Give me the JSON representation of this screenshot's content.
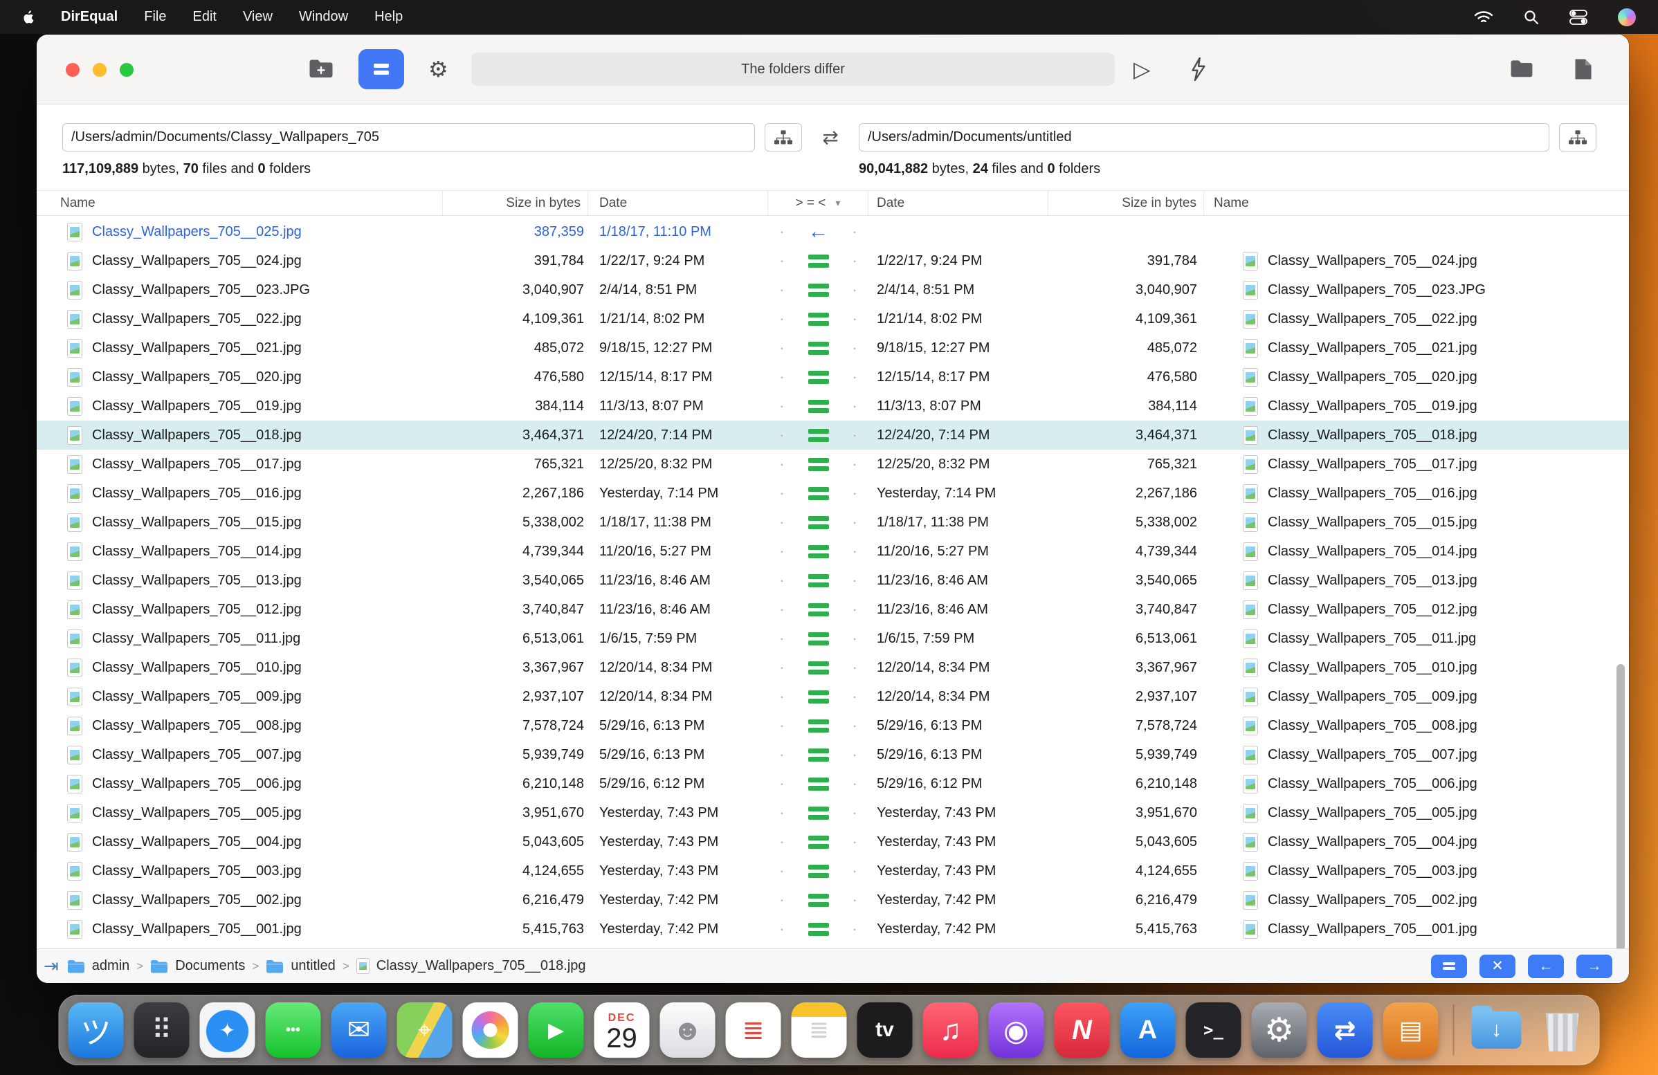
{
  "colors": {
    "accent": "#3d7bf7",
    "equal_green": "#2fae4d",
    "diff_blue": "#2e62d9",
    "selection": "#d7edef"
  },
  "icons": {
    "left_arrow": "←",
    "dot": "·",
    "chevron": "▾",
    "swap": "⇄",
    "play": "▷",
    "gear": "⚙",
    "bolt": "↯",
    "goto": "⇥",
    "breadcrumb_sep": ">",
    "copy_left": "←",
    "copy_right": "→",
    "diff_filter": "✕",
    "messages_glyph": "•••"
  },
  "menu_bar": {
    "app_name": "DirEqual",
    "menus": [
      "File",
      "Edit",
      "View",
      "Window",
      "Help"
    ]
  },
  "labels": {
    "bytes_sep": " bytes, ",
    "files_sep": " files and ",
    "folders_sep": " folders"
  },
  "window": {
    "status_text": "The folders differ",
    "left": {
      "path": "/Users/admin/Documents/Classy_Wallpapers_705",
      "bytes": "117,109,889",
      "files": "70",
      "folders": "0"
    },
    "right": {
      "path": "/Users/admin/Documents/untitled",
      "bytes": "90,041,882",
      "files": "24",
      "folders": "0"
    },
    "table": {
      "headers": {
        "name": "Name",
        "size": "Size in bytes",
        "date": "Date",
        "compare": ">  =  <"
      },
      "rows": [
        {
          "name": "Classy_Wallpapers_705__025.jpg",
          "size": "387,359",
          "date": "1/18/17, 11:10 PM",
          "compare": "left-only",
          "selected": false
        },
        {
          "name": "Classy_Wallpapers_705__024.jpg",
          "size": "391,784",
          "date": "1/22/17, 9:24 PM",
          "compare": "equal",
          "selected": false
        },
        {
          "name": "Classy_Wallpapers_705__023.JPG",
          "size": "3,040,907",
          "date": "2/4/14, 8:51 PM",
          "compare": "equal",
          "selected": false
        },
        {
          "name": "Classy_Wallpapers_705__022.jpg",
          "size": "4,109,361",
          "date": "1/21/14, 8:02 PM",
          "compare": "equal",
          "selected": false
        },
        {
          "name": "Classy_Wallpapers_705__021.jpg",
          "size": "485,072",
          "date": "9/18/15, 12:27 PM",
          "compare": "equal",
          "selected": false
        },
        {
          "name": "Classy_Wallpapers_705__020.jpg",
          "size": "476,580",
          "date": "12/15/14, 8:17 PM",
          "compare": "equal",
          "selected": false
        },
        {
          "name": "Classy_Wallpapers_705__019.jpg",
          "size": "384,114",
          "date": "11/3/13, 8:07 PM",
          "compare": "equal",
          "selected": false
        },
        {
          "name": "Classy_Wallpapers_705__018.jpg",
          "size": "3,464,371",
          "date": "12/24/20, 7:14 PM",
          "compare": "equal",
          "selected": true
        },
        {
          "name": "Classy_Wallpapers_705__017.jpg",
          "size": "765,321",
          "date": "12/25/20, 8:32 PM",
          "compare": "equal",
          "selected": false
        },
        {
          "name": "Classy_Wallpapers_705__016.jpg",
          "size": "2,267,186",
          "date": "Yesterday, 7:14 PM",
          "compare": "equal",
          "selected": false
        },
        {
          "name": "Classy_Wallpapers_705__015.jpg",
          "size": "5,338,002",
          "date": "1/18/17, 11:38 PM",
          "compare": "equal",
          "selected": false
        },
        {
          "name": "Classy_Wallpapers_705__014.jpg",
          "size": "4,739,344",
          "date": "11/20/16, 5:27 PM",
          "compare": "equal",
          "selected": false
        },
        {
          "name": "Classy_Wallpapers_705__013.jpg",
          "size": "3,540,065",
          "date": "11/23/16, 8:46 AM",
          "compare": "equal",
          "selected": false
        },
        {
          "name": "Classy_Wallpapers_705__012.jpg",
          "size": "3,740,847",
          "date": "11/23/16, 8:46 AM",
          "compare": "equal",
          "selected": false
        },
        {
          "name": "Classy_Wallpapers_705__011.jpg",
          "size": "6,513,061",
          "date": "1/6/15, 7:59 PM",
          "compare": "equal",
          "selected": false
        },
        {
          "name": "Classy_Wallpapers_705__010.jpg",
          "size": "3,367,967",
          "date": "12/20/14, 8:34 PM",
          "compare": "equal",
          "selected": false
        },
        {
          "name": "Classy_Wallpapers_705__009.jpg",
          "size": "2,937,107",
          "date": "12/20/14, 8:34 PM",
          "compare": "equal",
          "selected": false
        },
        {
          "name": "Classy_Wallpapers_705__008.jpg",
          "size": "7,578,724",
          "date": "5/29/16, 6:13 PM",
          "compare": "equal",
          "selected": false
        },
        {
          "name": "Classy_Wallpapers_705__007.jpg",
          "size": "5,939,749",
          "date": "5/29/16, 6:13 PM",
          "compare": "equal",
          "selected": false
        },
        {
          "name": "Classy_Wallpapers_705__006.jpg",
          "size": "6,210,148",
          "date": "5/29/16, 6:12 PM",
          "compare": "equal",
          "selected": false
        },
        {
          "name": "Classy_Wallpapers_705__005.jpg",
          "size": "3,951,670",
          "date": "Yesterday, 7:43 PM",
          "compare": "equal",
          "selected": false
        },
        {
          "name": "Classy_Wallpapers_705__004.jpg",
          "size": "5,043,605",
          "date": "Yesterday, 7:43 PM",
          "compare": "equal",
          "selected": false
        },
        {
          "name": "Classy_Wallpapers_705__003.jpg",
          "size": "4,124,655",
          "date": "Yesterday, 7:43 PM",
          "compare": "equal",
          "selected": false
        },
        {
          "name": "Classy_Wallpapers_705__002.jpg",
          "size": "6,216,479",
          "date": "Yesterday, 7:42 PM",
          "compare": "equal",
          "selected": false
        },
        {
          "name": "Classy_Wallpapers_705__001.jpg",
          "size": "5,415,763",
          "date": "Yesterday, 7:42 PM",
          "compare": "equal",
          "selected": false
        }
      ]
    },
    "statusbar": {
      "breadcrumbs": [
        {
          "type": "folder",
          "label": "admin"
        },
        {
          "type": "folder",
          "label": "Documents"
        },
        {
          "type": "folder",
          "label": "untitled"
        },
        {
          "type": "file",
          "label": "Classy_Wallpapers_705__018.jpg"
        }
      ]
    }
  },
  "dock": {
    "calendar": {
      "month": "DEC",
      "day": "29"
    },
    "items": [
      {
        "name": "finder",
        "glyph": "ツ",
        "bg": "linear-gradient(180deg,#59b8f5,#1b76dd)",
        "fs": 44
      },
      {
        "name": "launchpad",
        "glyph": "⠿",
        "bg": "linear-gradient(180deg,#3b3b40,#242428)",
        "fg": "#e2e2e6",
        "fs": 40
      },
      {
        "name": "safari",
        "glyph": "✦",
        "bg": "radial-gradient(circle at 50% 52%, #2a8ff2 0 30px, #f3f4f6 31px)",
        "fs": 28
      },
      {
        "name": "messages",
        "glyph": "•••",
        "bg": "linear-gradient(180deg,#67e97b,#16c22c)",
        "fs": 20,
        "bold": true
      },
      {
        "name": "mail",
        "glyph": "✉",
        "bg": "linear-gradient(180deg,#49a7f5,#1a64dc)",
        "fs": 40
      },
      {
        "name": "maps",
        "glyph": "⌖",
        "bg": "linear-gradient(118deg,#86d05c 0 44%,#f0d44c 44% 60%,#55a6ea 60%)",
        "fs": 34
      },
      {
        "name": "photos",
        "type": "photos",
        "bg": "#ffffff"
      },
      {
        "name": "facetime",
        "glyph": "▶",
        "bg": "linear-gradient(180deg,#4ee06a,#12b527)",
        "fs": 30
      },
      {
        "name": "calendar",
        "type": "calendar",
        "bg": "#ffffff"
      },
      {
        "name": "contacts",
        "glyph": "☻",
        "bg": "linear-gradient(180deg,#fdfdfd,#dcdce2)",
        "fg": "#8e8e96",
        "fs": 42
      },
      {
        "name": "reminders",
        "glyph": "≣",
        "bg": "#ffffff",
        "fg": "#e8453c",
        "fs": 38
      },
      {
        "name": "notes",
        "glyph": "≣",
        "bg": "linear-gradient(180deg,#f8c32c 0 26%,#ffffff 26%)",
        "fg": "#cfcfcf",
        "fs": 34
      },
      {
        "name": "apple-tv",
        "glyph": "tv",
        "bg": "#1c1c1e",
        "fs": 30,
        "bold": true
      },
      {
        "name": "music",
        "glyph": "♫",
        "bg": "linear-gradient(180deg,#fd6672,#ee2b4e)",
        "fs": 42
      },
      {
        "name": "podcasts",
        "glyph": "◉",
        "bg": "linear-gradient(180deg,#b274fa,#7331dc)",
        "fs": 42
      },
      {
        "name": "news",
        "glyph": "N",
        "bg": "linear-gradient(180deg,#fd5660,#d6293c)",
        "fs": 40,
        "bold": true,
        "italic": true
      },
      {
        "name": "app-store",
        "glyph": "A",
        "bg": "linear-gradient(180deg,#3ea2f6,#1266dd)",
        "fs": 38,
        "bold": true
      },
      {
        "name": "terminal",
        "glyph": ">_",
        "bg": "#242428",
        "fs": 24,
        "mono": true,
        "bold": true
      },
      {
        "name": "system-settings",
        "glyph": "⚙",
        "bg": "linear-gradient(180deg,#a9acb2,#5f6268)",
        "fs": 48
      },
      {
        "name": "direqual",
        "glyph": "⇄",
        "bg": "linear-gradient(180deg,#4a8df8,#2457d6)",
        "fs": 38,
        "bold": true
      },
      {
        "name": "text-editor",
        "glyph": "▤",
        "bg": "linear-gradient(180deg,#f2a34b,#d97420)",
        "fs": 36
      },
      {
        "name": "dock-separator",
        "type": "separator"
      },
      {
        "name": "downloads",
        "type": "downloads"
      },
      {
        "name": "trash",
        "type": "trash"
      }
    ]
  }
}
